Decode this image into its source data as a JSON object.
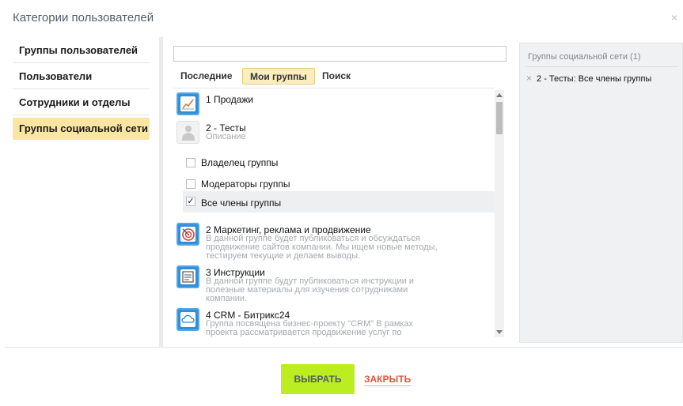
{
  "dialog": {
    "title": "Категории пользователей",
    "close_icon": "close-icon"
  },
  "nav": {
    "items": [
      {
        "label": "Группы пользователей",
        "active": false
      },
      {
        "label": "Пользователи",
        "active": false
      },
      {
        "label": "Сотрудники и отделы",
        "active": false
      },
      {
        "label": "Группы социальной сети",
        "active": true
      }
    ]
  },
  "search": {
    "value": "",
    "placeholder": ""
  },
  "tabs": [
    {
      "label": "Последние",
      "active": false
    },
    {
      "label": "Мои группы",
      "active": true
    },
    {
      "label": "Поиск",
      "active": false
    }
  ],
  "groups": [
    {
      "name": "1 Продажи",
      "description": "",
      "icon": "sales-chart-icon"
    },
    {
      "name": "2 - Тесты",
      "description": "Описание",
      "icon": "default-user-icon",
      "subitems": [
        {
          "label": "Владелец группы",
          "checked": false
        },
        {
          "label": "Модераторы группы",
          "checked": false
        },
        {
          "label": "Все члены группы",
          "checked": true
        }
      ]
    },
    {
      "name": "2 Маркетинг, реклама и продвижение",
      "description": "В данной группе будет публиковаться и обсуждаться продвижение сайтов компании. Мы ищем новые методы, тестируем текущие и делаем выводы.",
      "icon": "target-icon"
    },
    {
      "name": "3 Инструкции",
      "description": "В данной группе будут публиковаться инструкции и полезные материалы для изучения сотрудниками компании.",
      "icon": "instructions-icon"
    },
    {
      "name": "4 CRM - Битрикс24",
      "description": "Группа посвящена бизнес-проекту \"CRM\" В рамках проекта рассматривается продвижение услуг по",
      "icon": "cloud-icon"
    }
  ],
  "selected_panel": {
    "title": "Группы социальной сети (1)",
    "items": [
      {
        "label": "2 - Тесты: Все члены группы"
      }
    ]
  },
  "footer": {
    "select_label": "ВЫБРАТЬ",
    "close_label": "ЗАКРЫТЬ"
  },
  "colors": {
    "accent_green": "#bbed21",
    "active_nav": "#fbe5a3",
    "close_red": "#e0553b"
  }
}
